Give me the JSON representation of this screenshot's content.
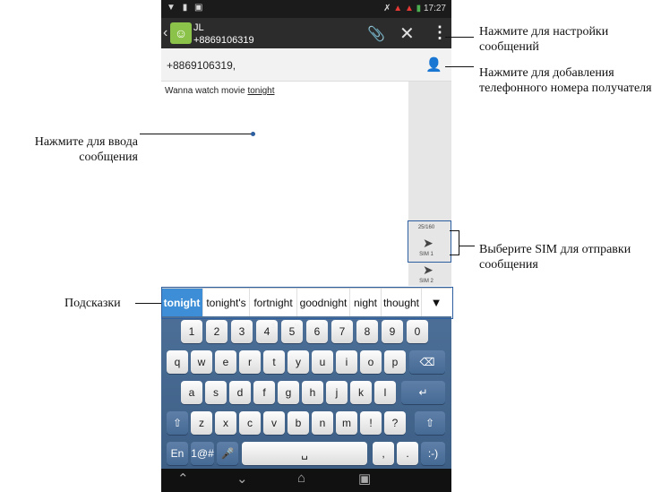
{
  "statusbar": {
    "time": "17:27"
  },
  "header": {
    "name": "JL",
    "phone": "+8869106319"
  },
  "recipient": {
    "number": "+8869106319,"
  },
  "message": {
    "text": "Wanna watch movie ",
    "underlined": "tonight"
  },
  "counter": "25/160",
  "sim": {
    "sim1": "SIM 1",
    "sim2": "SIM 2"
  },
  "suggestions": [
    "tonight",
    "tonight's",
    "fortnight",
    "goodnight",
    "night",
    "thought"
  ],
  "keyboard": {
    "row1": [
      "1",
      "2",
      "3",
      "4",
      "5",
      "6",
      "7",
      "8",
      "9",
      "0"
    ],
    "row1_sup": [
      "!",
      "@",
      "#",
      "$",
      "%",
      "^",
      "&",
      "*",
      "(",
      ")"
    ],
    "row2": [
      "q",
      "w",
      "e",
      "r",
      "t",
      "y",
      "u",
      "i",
      "o",
      "p"
    ],
    "row3": [
      "a",
      "s",
      "d",
      "f",
      "g",
      "h",
      "j",
      "k",
      "l"
    ],
    "row4": [
      "z",
      "x",
      "c",
      "v",
      "b",
      "n",
      "m",
      "!",
      "?"
    ],
    "lang": "En",
    "symbols": "1@#",
    "comma": ",",
    "period": ".",
    "emoji": ":-)"
  },
  "annotations": {
    "settings": "Нажмите для настройки сообщений",
    "add_phone": "Нажмите для добавления телефонного номера получателя",
    "input": "Нажмите для ввода сообщения",
    "sim": "Выберите SIM для отправки сообщения",
    "hints": "Подсказки"
  },
  "colors": {
    "accent": "#3d8ed6",
    "keyboard_bg": "#456a94",
    "annotation": "#2d5fa0"
  }
}
